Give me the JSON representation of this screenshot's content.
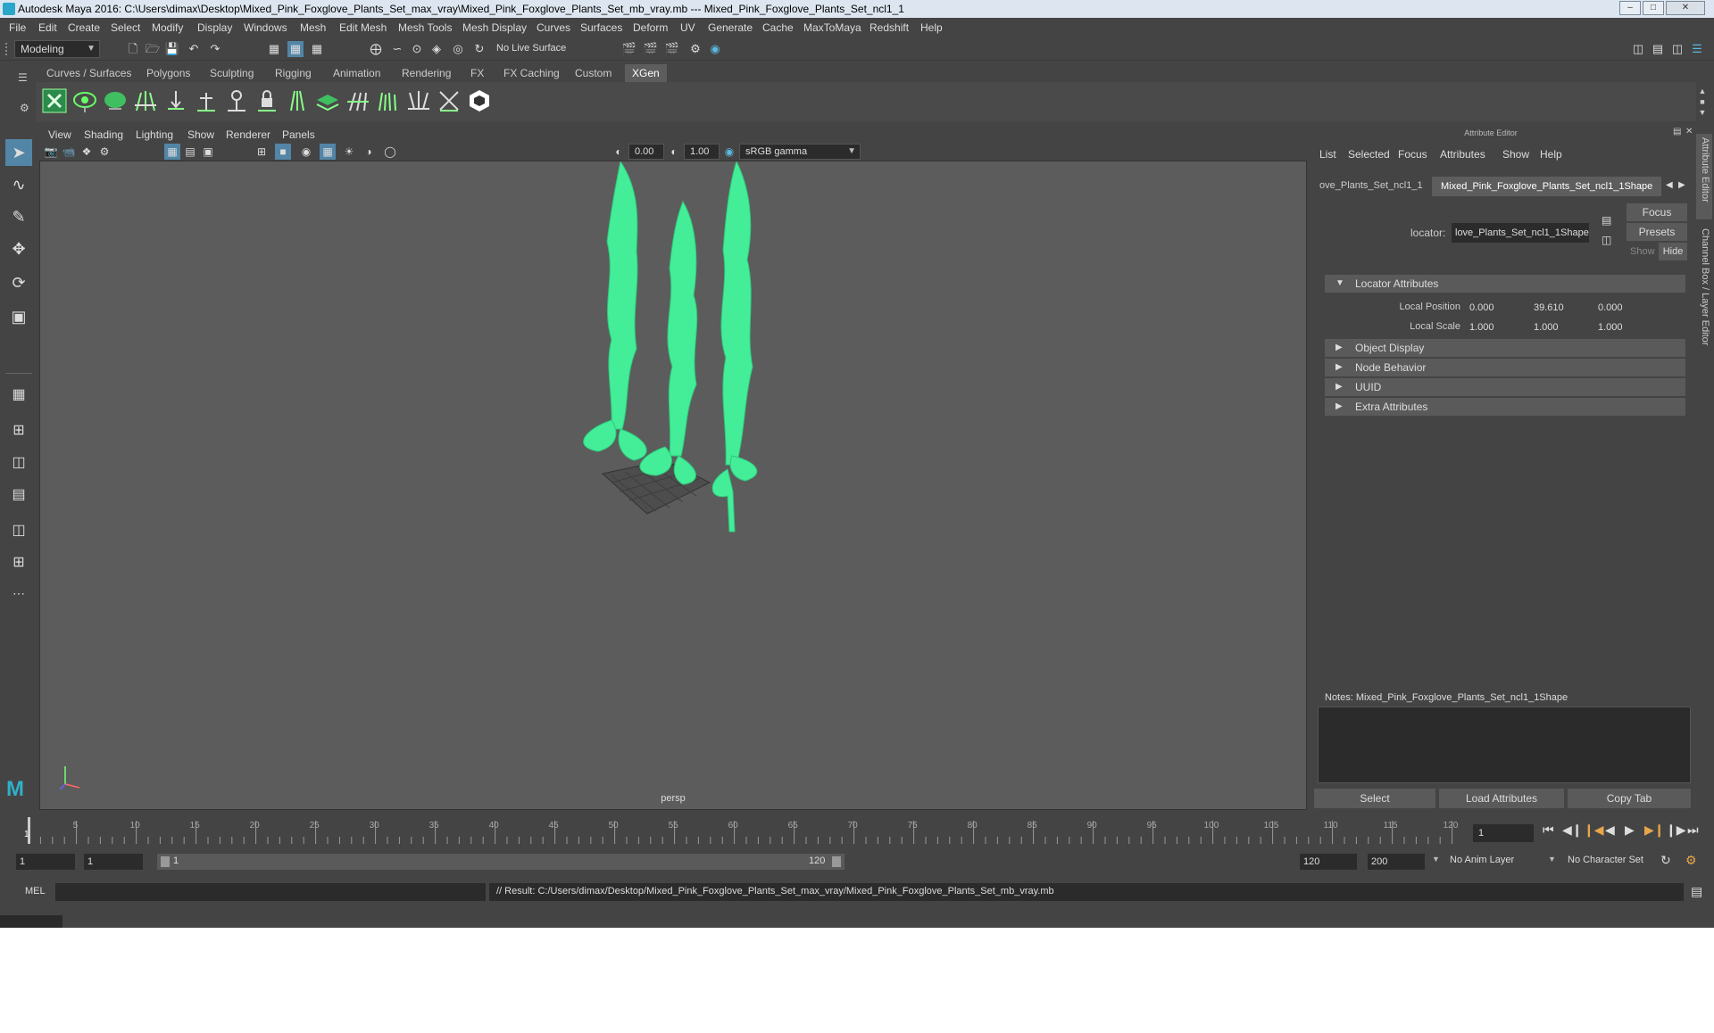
{
  "window": {
    "title": "Autodesk Maya 2016: C:\\Users\\dimax\\Desktop\\Mixed_Pink_Foxglove_Plants_Set_max_vray\\Mixed_Pink_Foxglove_Plants_Set_mb_vray.mb   ---   Mixed_Pink_Foxglove_Plants_Set_ncl1_1"
  },
  "menubar": [
    "File",
    "Edit",
    "Create",
    "Select",
    "Modify",
    "Display",
    "Windows",
    "Mesh",
    "Edit Mesh",
    "Mesh Tools",
    "Mesh Display",
    "Curves",
    "Surfaces",
    "Deform",
    "UV",
    "Generate",
    "Cache",
    "MaxToMaya",
    "Redshift",
    "Help"
  ],
  "statusline": {
    "mode": "Modeling",
    "live_surface": "No Live Surface"
  },
  "shelf": {
    "tabs": [
      "Curves / Surfaces",
      "Polygons",
      "Sculpting",
      "Rigging",
      "Animation",
      "Rendering",
      "FX",
      "FX Caching",
      "Custom",
      "XGen"
    ],
    "active_tab": "XGen"
  },
  "viewport": {
    "menu": [
      "View",
      "Shading",
      "Lighting",
      "Show",
      "Renderer",
      "Panels"
    ],
    "exposure": "0.00",
    "gamma": "1.00",
    "color_space": "sRGB gamma",
    "camera": "persp"
  },
  "attribute_editor": {
    "title": "Attribute Editor",
    "menu": [
      "List",
      "Selected",
      "Focus",
      "Attributes",
      "Show",
      "Help"
    ],
    "tabs": [
      "ove_Plants_Set_ncl1_1",
      "Mixed_Pink_Foxglove_Plants_Set_ncl1_1Shape"
    ],
    "node_label": "locator:",
    "node_name": "love_Plants_Set_ncl1_1Shape",
    "focus_btn": "Focus",
    "presets_btn": "Presets",
    "show_btn": "Show",
    "hide_btn": "Hide",
    "sections": {
      "locator": "Locator Attributes",
      "object_display": "Object Display",
      "node_behavior": "Node Behavior",
      "uuid": "UUID",
      "extra": "Extra Attributes"
    },
    "local_position": {
      "label": "Local Position",
      "x": "0.000",
      "y": "39.610",
      "z": "0.000"
    },
    "local_scale": {
      "label": "Local Scale",
      "x": "1.000",
      "y": "1.000",
      "z": "1.000"
    },
    "notes_label": "Notes:  Mixed_Pink_Foxglove_Plants_Set_ncl1_1Shape",
    "buttons": {
      "select": "Select",
      "load": "Load Attributes",
      "copy": "Copy Tab"
    }
  },
  "side_tabs": {
    "ae": "Attribute Editor",
    "cb": "Channel Box / Layer Editor"
  },
  "timeline": {
    "ticks": [
      "5",
      "10",
      "15",
      "20",
      "25",
      "30",
      "35",
      "40",
      "45",
      "50",
      "55",
      "60",
      "65",
      "70",
      "75",
      "80",
      "85",
      "90",
      "95",
      "100",
      "105",
      "110",
      "115",
      "120"
    ],
    "start_label": "1",
    "current_frame": "1"
  },
  "range": {
    "start": "1",
    "playback_start": "1",
    "slider_start": "1",
    "slider_end": "120",
    "playback_end": "120",
    "end": "200",
    "anim_layer": "No Anim Layer",
    "character_set": "No Character Set"
  },
  "command": {
    "lang": "MEL",
    "result": "// Result: C:/Users/dimax/Desktop/Mixed_Pink_Foxglove_Plants_Set_max_vray/Mixed_Pink_Foxglove_Plants_Set_mb_vray.mb"
  },
  "colors": {
    "plant": "#44ee99",
    "panel": "#444444",
    "viewport": "#5c5c5c",
    "accent": "#5285a6"
  }
}
